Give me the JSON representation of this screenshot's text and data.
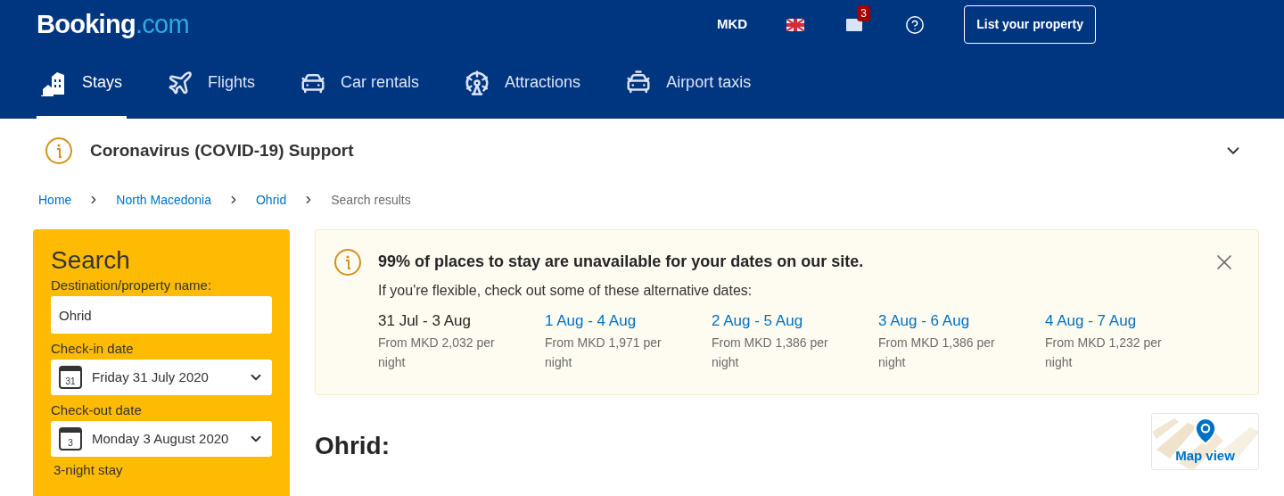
{
  "header": {
    "logo": {
      "main": "Booking",
      "suffix": ".com"
    },
    "currency": "MKD",
    "messages_badge": "3",
    "list_property_button": "List your property"
  },
  "nav_tabs": [
    {
      "label": "Stays",
      "kind": "stays",
      "selected": true
    },
    {
      "label": "Flights",
      "kind": "flights",
      "selected": false
    },
    {
      "label": "Car rentals",
      "kind": "car",
      "selected": false
    },
    {
      "label": "Attractions",
      "kind": "attractions",
      "selected": false
    },
    {
      "label": "Airport taxis",
      "kind": "taxi",
      "selected": false
    }
  ],
  "covid_banner": {
    "title": "Coronavirus (COVID-19) Support",
    "expanded": false
  },
  "breadcrumbs": [
    {
      "label": "Home",
      "current": false
    },
    {
      "label": "North Macedonia",
      "current": false
    },
    {
      "label": "Ohrid",
      "current": false
    },
    {
      "label": "Search results",
      "current": true
    }
  ],
  "search_panel": {
    "title": "Search",
    "destination_label": "Destination/property name:",
    "destination_value": "Ohrid",
    "checkin_label": "Check-in date",
    "checkin_day": "31",
    "checkin_value": "Friday 31 July 2020",
    "checkout_label": "Check-out date",
    "checkout_day": "3",
    "checkout_value": "Monday 3 August 2020",
    "stay_length": "3-night stay"
  },
  "alert": {
    "title": "99% of places to stay are unavailable for your dates on our site.",
    "subtitle": "If you're flexible, check out some of these alternative dates:",
    "dates": [
      {
        "range": "31 Jul - 3 Aug",
        "price": "From MKD 2,032 per night",
        "selected": true
      },
      {
        "range": "1 Aug - 4 Aug",
        "price": "From MKD 1,971 per night",
        "selected": false
      },
      {
        "range": "2 Aug - 5 Aug",
        "price": "From MKD 1,386 per night",
        "selected": false
      },
      {
        "range": "3 Aug - 6 Aug",
        "price": "From MKD 1,386 per night",
        "selected": false
      },
      {
        "range": "4 Aug - 7 Aug",
        "price": "From MKD 1,232 per night",
        "selected": false
      }
    ]
  },
  "results": {
    "heading": "Ohrid:",
    "map_button": "Map view"
  }
}
